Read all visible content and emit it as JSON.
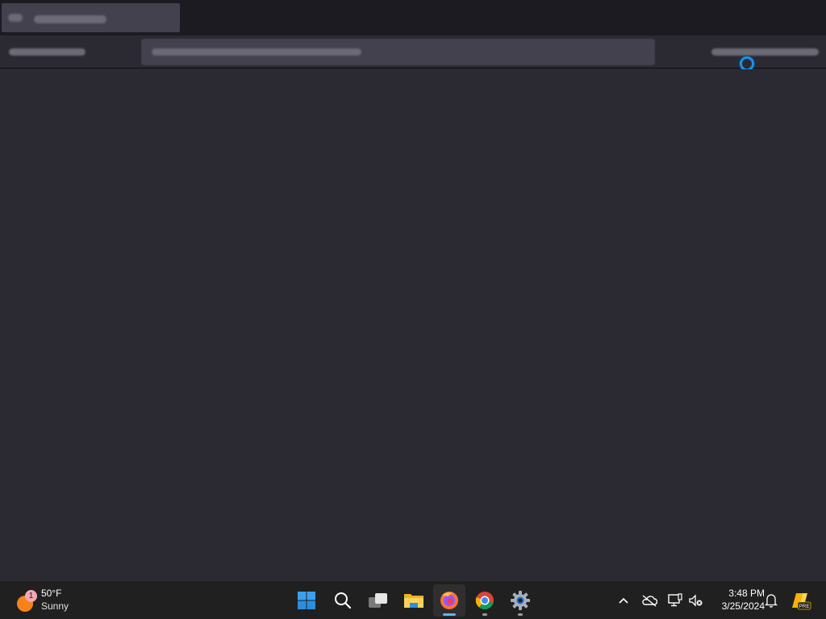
{
  "taskbar": {
    "weather": {
      "badge": "1",
      "temperature": "50°F",
      "condition": "Sunny"
    },
    "apps": [
      {
        "name": "Start",
        "icon": "windows-start-icon"
      },
      {
        "name": "Search",
        "icon": "search-icon"
      },
      {
        "name": "Task View",
        "icon": "task-view-icon"
      },
      {
        "name": "File Explorer",
        "icon": "folder-icon"
      },
      {
        "name": "Firefox",
        "icon": "firefox-icon",
        "state": "active"
      },
      {
        "name": "Chrome",
        "icon": "chrome-icon",
        "state": "open"
      },
      {
        "name": "Settings",
        "icon": "settings-gear-icon",
        "state": "open"
      }
    ],
    "clock": {
      "time": "3:48 PM",
      "date": "3/25/2024"
    },
    "tray_badge": "PRE"
  },
  "colors": {
    "page_background": "#2b2a33",
    "titlebar": "#1c1b22",
    "taskbar": "#202020",
    "accent": "#5fb3f2",
    "busy_cursor": "#1e90e8"
  }
}
